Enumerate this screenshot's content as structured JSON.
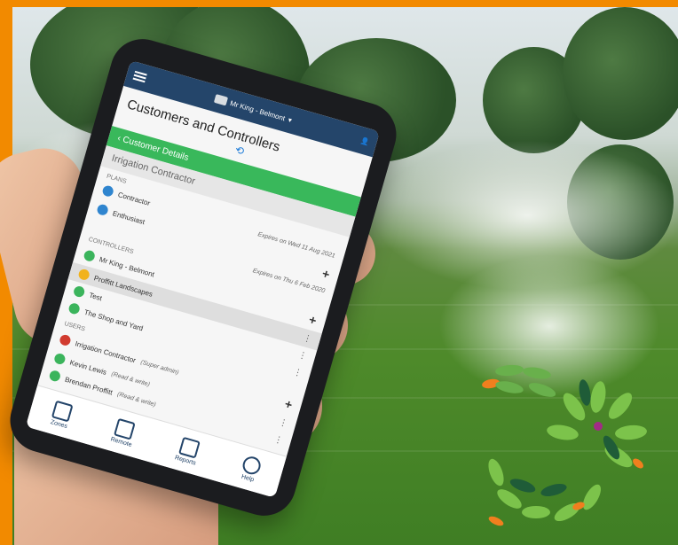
{
  "app": {
    "header_customer": "Mr King - Belmont",
    "page_title": "Customers and Controllers",
    "details_label": "Customer Details",
    "customer_type": "Irrigation Contractor"
  },
  "sections": {
    "plans": "PLANS",
    "controllers": "CONTROLLERS",
    "users": "USERS"
  },
  "plans": [
    {
      "name": "Contractor",
      "expires": "Expires on Wed 11 Aug 2021"
    },
    {
      "name": "Enthusiast",
      "expires": "Expires on Thu 6 Feb 2020"
    }
  ],
  "controllers": [
    {
      "name": "Mr King - Belmont"
    },
    {
      "name": "Proffitt Landscapes"
    },
    {
      "name": "Test"
    },
    {
      "name": "The Shop and Yard"
    }
  ],
  "users": [
    {
      "name": "Irrigation Contractor",
      "role": "(Super admin)"
    },
    {
      "name": "Kevin Lewis",
      "role": "(Read & write)"
    },
    {
      "name": "Brendan Proffitt",
      "role": "(Read & write)"
    }
  ],
  "bottom_nav": [
    {
      "label": "Zones",
      "icon": "zones-icon"
    },
    {
      "label": "Remote",
      "icon": "remote-icon"
    },
    {
      "label": "Reports",
      "icon": "reports-icon"
    },
    {
      "label": "Help",
      "icon": "help-icon"
    }
  ]
}
